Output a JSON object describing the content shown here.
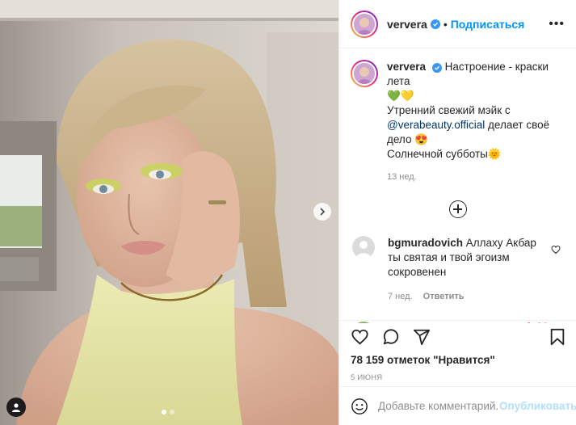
{
  "post": {
    "author": "ververa",
    "follow_label": "Подписаться",
    "separator": "•",
    "more_label": "•••",
    "caption": {
      "username": "ververa",
      "line1": "Настроение - краски лета",
      "line2_prefix": "Утренний свежий мэйк с ",
      "mention": "@verabeauty.official",
      "line2_suffix": " делает своё дело",
      "line3": "Солнечной субботы",
      "emoji_hearts": "💚💛",
      "emoji_eyes": "😍",
      "emoji_sun": "🌞",
      "time": "13 нед."
    },
    "comments": [
      {
        "username": "bgmuradovich",
        "text": "Аллаху Акбар ты святая и твой эгоизм сокровенен",
        "time": "7 нед.",
        "reply_label": "Ответить"
      },
      {
        "username": "pavlovoposadski_sharfer",
        "emoji": "🔥❤️"
      }
    ],
    "likes": "78 159 отметок \"Нравится\"",
    "date": "5 июня",
    "add_comment_placeholder": "Добавьте комментарий...",
    "publish_label": "Опубликовать",
    "carousel": {
      "count": 2,
      "active": 0
    }
  },
  "colors": {
    "accent": "#0095f6",
    "verified": "#3897f0",
    "publish_disabled": "#b2dffc",
    "muted": "#8e8e8e",
    "text": "#262626"
  },
  "icons": {
    "verified": "verified-badge-icon",
    "like": "heart-icon",
    "comment": "comment-bubble-icon",
    "share": "paper-plane-icon",
    "save": "bookmark-icon",
    "emoji": "smiley-icon",
    "next": "chevron-right-icon",
    "tag": "person-tag-icon",
    "load_more": "plus-circle-icon"
  }
}
